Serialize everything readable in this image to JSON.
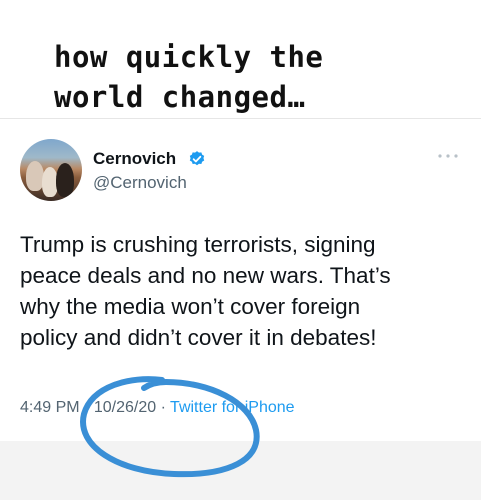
{
  "caption": {
    "line1": "how quickly the",
    "line2": "world changed…"
  },
  "tweet": {
    "display_name": "Cernovich",
    "handle": "@Cernovich",
    "text_lines": [
      "Trump is crushing terrorists, signing",
      "peace deals and no new wars. That’s",
      "why the media won’t cover foreign",
      "policy and didn’t cover it in debates!"
    ],
    "time": "4:49 PM",
    "date": "10/26/20",
    "separator": "·",
    "source": "Twitter for iPhone"
  },
  "colors": {
    "verified_badge": "#1d9bf0",
    "source_link": "#1d9bf0",
    "annotation_circle": "#3a8fd6"
  },
  "icons": {
    "verified": "verified-badge-icon",
    "more": "more-dots-icon"
  }
}
